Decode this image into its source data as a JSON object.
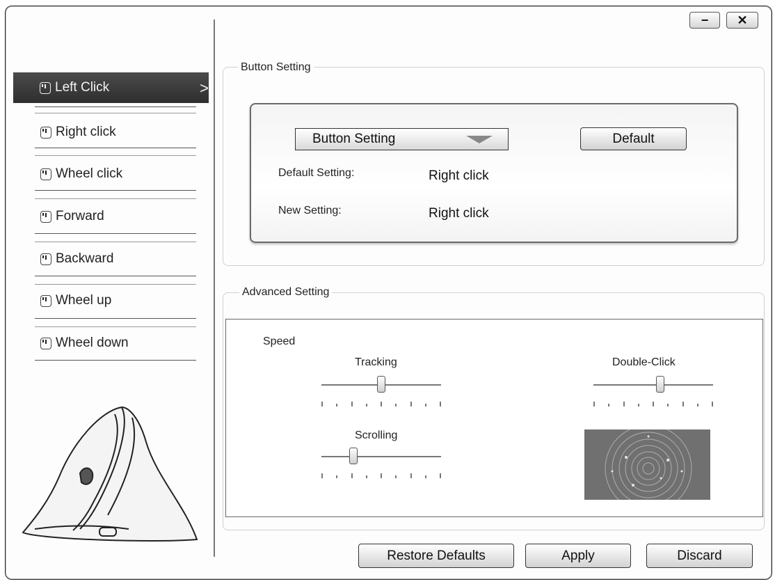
{
  "window_controls": {
    "minimize": "−",
    "close": "✕"
  },
  "sidebar": {
    "items": [
      {
        "label": "Left Click",
        "active": true
      },
      {
        "label": "Right click"
      },
      {
        "label": "Wheel click"
      },
      {
        "label": "Forward"
      },
      {
        "label": "Backward"
      },
      {
        "label": "Wheel up"
      },
      {
        "label": "Wheel down"
      }
    ],
    "active_chevron": ">"
  },
  "button_setting": {
    "group_title": "Button Setting",
    "dropdown_value": "Button Setting",
    "default_button": "Default",
    "default_label": "Default Setting:",
    "default_value": "Right click",
    "new_label": "New Setting:",
    "new_value": "Right click"
  },
  "advanced_setting": {
    "group_title": "Advanced Setting",
    "speed_label": "Speed",
    "tracking_label": "Tracking",
    "tracking_level": 0.5,
    "double_click_label": "Double-Click",
    "double_click_level": 0.56,
    "scrolling_label": "Scrolling",
    "scrolling_level": 0.27
  },
  "footer": {
    "restore_defaults": "Restore Defaults",
    "apply": "Apply",
    "discard": "Discard"
  }
}
